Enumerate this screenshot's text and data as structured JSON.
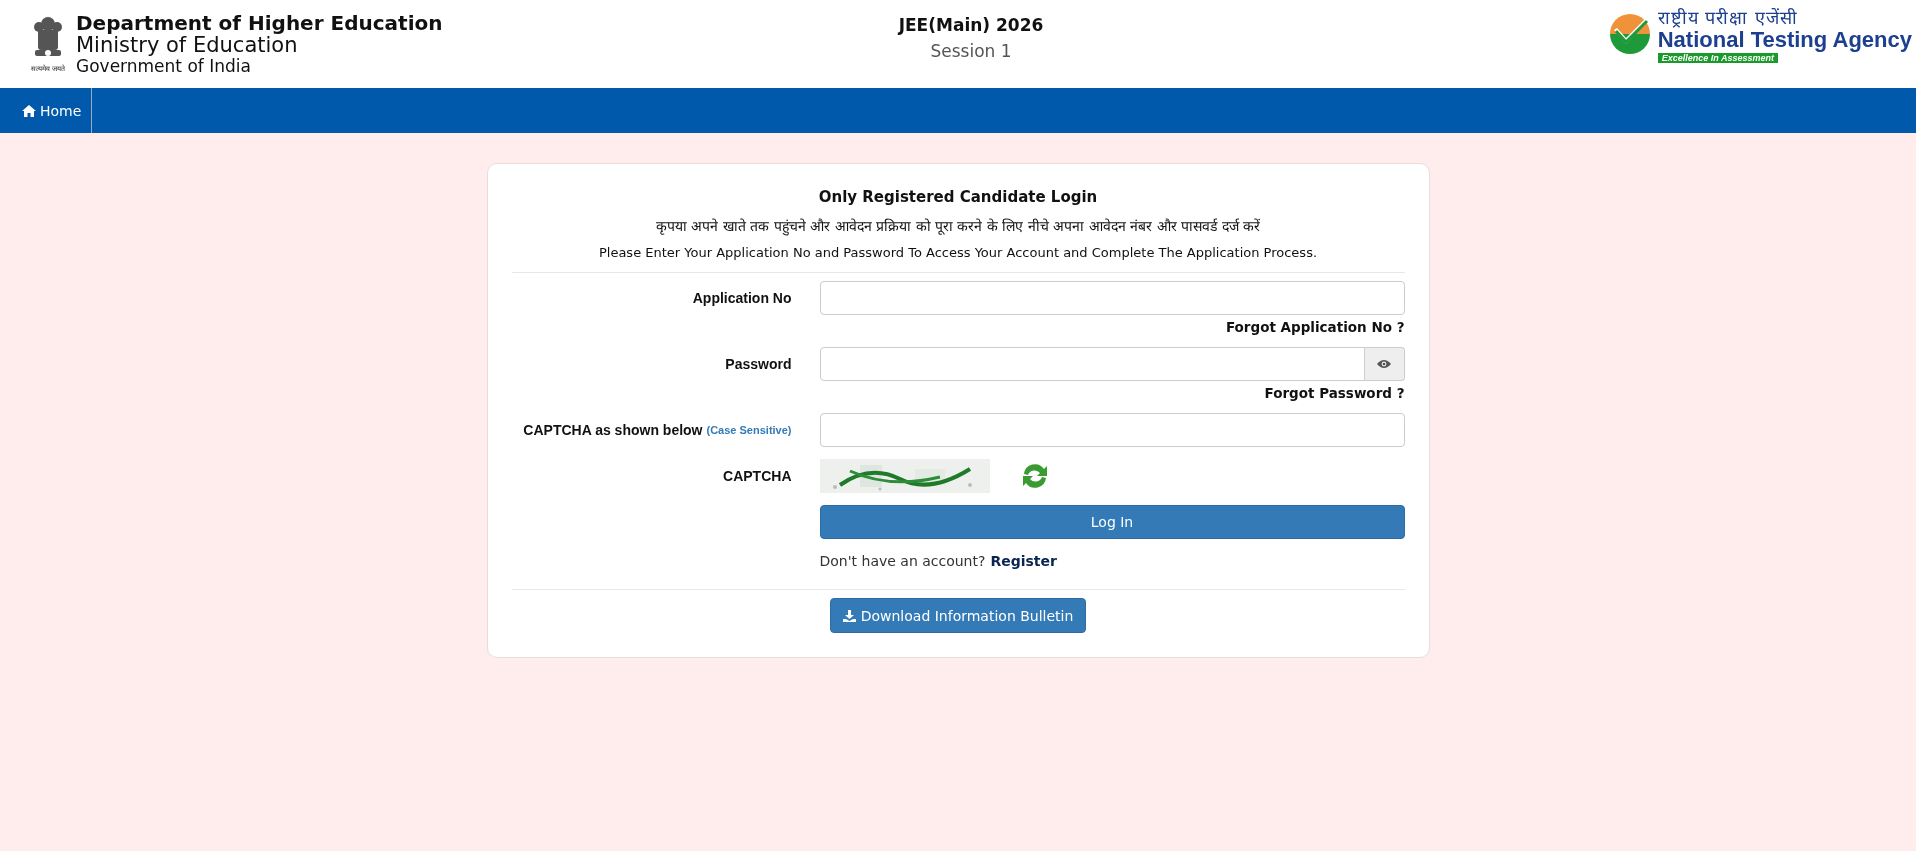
{
  "header": {
    "motto": "सत्यमेव जयते",
    "department": "Department of Higher Education",
    "ministry": "Ministry of Education",
    "government": "Government of India"
  },
  "exam": {
    "title": "JEE(Main) 2026",
    "session": "Session 1"
  },
  "agency": {
    "hindi": "राष्ट्रीय परीक्षा एजेंसी",
    "name": "National Testing Agency",
    "tagline": "Excellence In Assessment"
  },
  "nav": [
    {
      "label": "Home"
    }
  ],
  "login": {
    "title": "Only Registered Candidate Login",
    "hindi_instruction": "कृपया अपने खाते तक पहुंचने और आवेदन प्रक्रिया को पूरा करने के लिए नीचे अपना आवेदन नंबर और पासवर्ड दर्ज करें",
    "instruction": "Please Enter Your Application No and Password To Access Your Account and Complete The Application Process.",
    "fields": [
      {
        "kind": "text",
        "label": "Application No",
        "link": "Forgot Application No ?"
      },
      {
        "kind": "password",
        "label": "Password",
        "link": "Forgot Password ?"
      },
      {
        "kind": "text",
        "label": "CAPTCHA as shown below",
        "note": "(Case Sensitive)"
      },
      {
        "kind": "captcha",
        "label": "CAPTCHA"
      }
    ],
    "submit": "Log In",
    "register_prompt": "Don't have an account?",
    "register_link": "Register",
    "download": "Download Information Bulletin"
  }
}
